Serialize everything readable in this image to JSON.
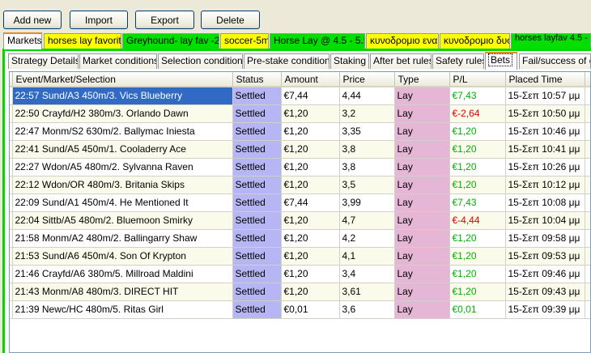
{
  "toolbar": {
    "add_new": "Add new",
    "import": "Import",
    "export": "Export",
    "delete": "Delete"
  },
  "strategy_tabs": [
    {
      "label": "Markets",
      "color": "#fcfcfe",
      "active": true
    },
    {
      "label": "horses lay favorite",
      "color": "#ffff00"
    },
    {
      "label": "Greyhound- lay fav -2m",
      "color": "#00e000"
    },
    {
      "label": "soccer-5m",
      "color": "#ffff00"
    },
    {
      "label": "Horse Lay  @ 4.5 - 5.5",
      "color": "#00e000"
    },
    {
      "label": "κυνοδρομιο ενα",
      "color": "#ffff00"
    },
    {
      "label": "κυνοδρομιο δυο",
      "color": "#ffff00"
    },
    {
      "label": "horses layfav 4.5 - 2m",
      "color": "#00e000"
    }
  ],
  "sub_tabs": [
    {
      "label": "Strategy Details"
    },
    {
      "label": "Market conditions"
    },
    {
      "label": "Selection conditions"
    },
    {
      "label": "Pre-stake conditions"
    },
    {
      "label": "Staking"
    },
    {
      "label": "After bet rules"
    },
    {
      "label": "Safety rules"
    },
    {
      "label": "Bets",
      "active": true
    },
    {
      "label": "Fail/success of co"
    }
  ],
  "columns": [
    "Event/Market/Selection",
    "Status",
    "Amount",
    "Price",
    "Type",
    "P/L",
    "Placed Time"
  ],
  "rows": [
    {
      "event": "22:57 Sund/A3 450m/3. Vics Blueberry",
      "status": "Settled",
      "amount": "€7,44",
      "price": "4,44",
      "type": "Lay",
      "pl": "€7,43",
      "pl_sign": "pos",
      "time": "15-Σεπ 10:57 μμ"
    },
    {
      "event": "22:50 Crayfd/H2 380m/3. Orlando Dawn",
      "status": "Settled",
      "amount": "€1,20",
      "price": "3,2",
      "type": "Lay",
      "pl": "€-2,64",
      "pl_sign": "neg",
      "time": "15-Σεπ 10:50 μμ"
    },
    {
      "event": "22:47 Monm/S2 630m/2. Ballymac Iniesta",
      "status": "Settled",
      "amount": "€1,20",
      "price": "3,35",
      "type": "Lay",
      "pl": "€1,20",
      "pl_sign": "pos",
      "time": "15-Σεπ 10:46 μμ"
    },
    {
      "event": "22:41 Sund/A5 450m/1. Cooladerry Ace",
      "status": "Settled",
      "amount": "€1,20",
      "price": "3,8",
      "type": "Lay",
      "pl": "€1,20",
      "pl_sign": "pos",
      "time": "15-Σεπ 10:41 μμ"
    },
    {
      "event": "22:27 Wdon/A5 480m/2. Sylvanna Raven",
      "status": "Settled",
      "amount": "€1,20",
      "price": "3,8",
      "type": "Lay",
      "pl": "€1,20",
      "pl_sign": "pos",
      "time": "15-Σεπ 10:26 μμ"
    },
    {
      "event": "22:12 Wdon/OR 480m/3. Britania Skips",
      "status": "Settled",
      "amount": "€1,20",
      "price": "3,5",
      "type": "Lay",
      "pl": "€1,20",
      "pl_sign": "pos",
      "time": "15-Σεπ 10:12 μμ"
    },
    {
      "event": "22:09 Sund/A1 450m/4. He Mentioned It",
      "status": "Settled",
      "amount": "€7,44",
      "price": "3,99",
      "type": "Lay",
      "pl": "€7,43",
      "pl_sign": "pos",
      "time": "15-Σεπ 10:08 μμ"
    },
    {
      "event": "22:04 Sittb/A5 480m/2. Bluemoon Smirky",
      "status": "Settled",
      "amount": "€1,20",
      "price": "4,7",
      "type": "Lay",
      "pl": "€-4,44",
      "pl_sign": "neg",
      "time": "15-Σεπ 10:04 μμ"
    },
    {
      "event": "21:58 Monm/A2 480m/2. Ballingarry Shaw",
      "status": "Settled",
      "amount": "€1,20",
      "price": "4,2",
      "type": "Lay",
      "pl": "€1,20",
      "pl_sign": "pos",
      "time": "15-Σεπ 09:58 μμ"
    },
    {
      "event": "21:53 Sund/A6 450m/4. Son Of Krypton",
      "status": "Settled",
      "amount": "€1,20",
      "price": "4,1",
      "type": "Lay",
      "pl": "€1,20",
      "pl_sign": "pos",
      "time": "15-Σεπ 09:53 μμ"
    },
    {
      "event": "21:46 Crayfd/A6 380m/5. Millroad Maldini",
      "status": "Settled",
      "amount": "€1,20",
      "price": "3,4",
      "type": "Lay",
      "pl": "€1,20",
      "pl_sign": "pos",
      "time": "15-Σεπ 09:46 μμ"
    },
    {
      "event": "21:43 Monm/A8 480m/3. DIRECT HIT",
      "status": "Settled",
      "amount": "€1,20",
      "price": "3,61",
      "type": "Lay",
      "pl": "€1,20",
      "pl_sign": "pos",
      "time": "15-Σεπ 09:43 μμ"
    },
    {
      "event": "21:39 Newc/HC 480m/5. Ritas Girl",
      "status": "Settled",
      "amount": "€0,01",
      "price": "3,6",
      "type": "Lay",
      "pl": "€0,01",
      "pl_sign": "pos",
      "time": "15-Σεπ 09:39 μμ"
    }
  ]
}
